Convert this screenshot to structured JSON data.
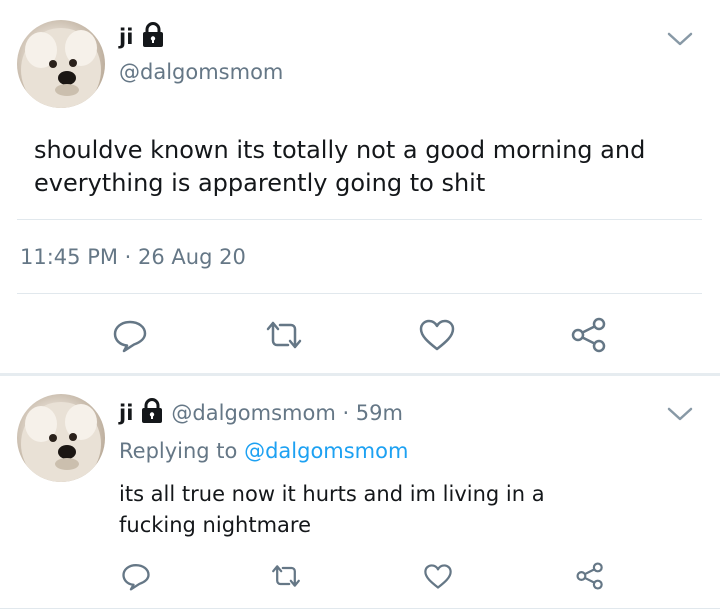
{
  "main_tweet": {
    "name": "ji",
    "handle": "@dalgomsmom",
    "text": "shouldve known its totally not a good morning and everything is apparently going to shit",
    "timestamp": "11:45 PM · 26 Aug 20",
    "icons": [
      "lock-icon",
      "chevron-down-icon",
      "reply-icon",
      "retweet-icon",
      "like-icon",
      "share-icon"
    ]
  },
  "reply_tweet": {
    "name": "ji",
    "handle_time": "@dalgomsmom · 59m",
    "replying_prefix": "Replying to ",
    "replying_to": "@dalgomsmom",
    "text": "its all true now it hurts and im living in a fucking nightmare"
  },
  "colors": {
    "text": "#14171a",
    "secondary": "#657786",
    "accent": "#1da1f2",
    "divider": "#e1e8ed"
  }
}
